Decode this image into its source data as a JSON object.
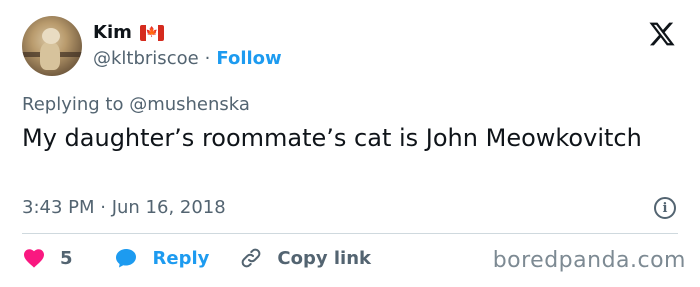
{
  "user": {
    "name": "Kim",
    "handle": "@kltbriscoe",
    "separator": "·",
    "follow_label": "Follow"
  },
  "reply": {
    "text": "Replying to @mushenska"
  },
  "tweet": {
    "text": "My daughter’s roommate’s cat is John Meowkovitch"
  },
  "meta": {
    "time": "3:43 PM · Jun 16, 2018"
  },
  "actions": {
    "likes_count": "5",
    "reply_label": "Reply",
    "copy_label": "Copy link"
  },
  "watermark": "boredpanda.com",
  "colors": {
    "accent": "#1d9bf0",
    "like": "#f91880",
    "muted": "#536471",
    "flag_red": "#d52b1e"
  },
  "icons": [
    "x-logo-icon",
    "canada-flag-icon",
    "info-icon",
    "heart-icon",
    "reply-bubble-icon",
    "link-icon"
  ]
}
